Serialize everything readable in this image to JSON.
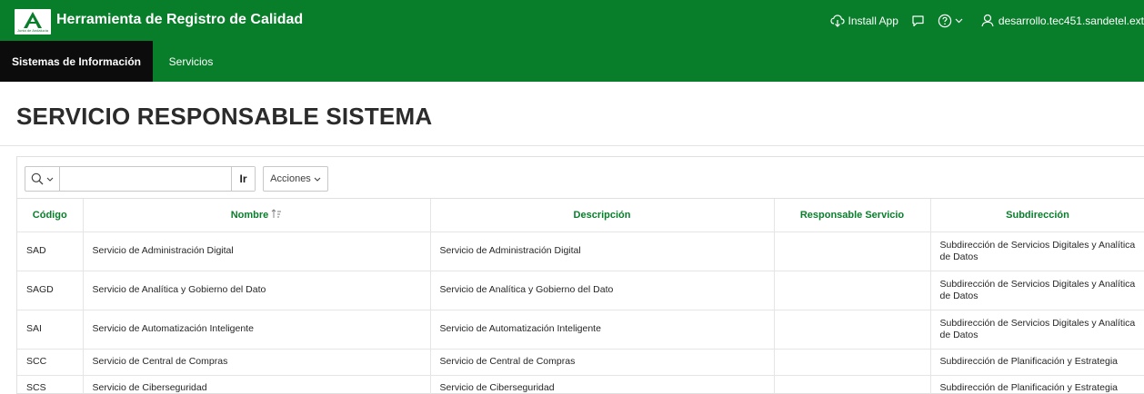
{
  "header": {
    "logo_text": "Junta de Andalucía",
    "title": "Herramienta de Registro de Calidad",
    "install_label": "Install App",
    "username": "desarrollo.tec451.sandetel.ext"
  },
  "nav": {
    "tabs": [
      {
        "label": "Sistemas de Información",
        "active": true
      },
      {
        "label": "Servicios",
        "active": false
      }
    ]
  },
  "page": {
    "title": "SERVICIO RESPONSABLE SISTEMA"
  },
  "toolbar": {
    "search_value": "",
    "search_placeholder": "",
    "go_label": "Ir",
    "actions_label": "Acciones"
  },
  "table": {
    "columns": [
      "Código",
      "Nombre",
      "Descripción",
      "Responsable Servicio",
      "Subdirección"
    ],
    "sorted_column": "Nombre",
    "rows": [
      {
        "codigo": "SAD",
        "nombre": "Servicio de Administración Digital",
        "descripcion": "Servicio de Administración Digital",
        "responsable": "",
        "subdireccion": "Subdirección de Servicios Digitales y Analítica de Datos"
      },
      {
        "codigo": "SAGD",
        "nombre": "Servicio de Analítica y Gobierno del Dato",
        "descripcion": "Servicio de Analítica y Gobierno del Dato",
        "responsable": "",
        "subdireccion": "Subdirección de Servicios Digitales y Analítica de Datos"
      },
      {
        "codigo": "SAI",
        "nombre": "Servicio de Automatización Inteligente",
        "descripcion": "Servicio de Automatización Inteligente",
        "responsable": "",
        "subdireccion": "Subdirección de Servicios Digitales y Analítica de Datos"
      },
      {
        "codigo": "SCC",
        "nombre": "Servicio de Central de Compras",
        "descripcion": "Servicio de Central de Compras",
        "responsable": "",
        "subdireccion": "Subdirección de Planificación y Estrategia"
      },
      {
        "codigo": "SCS",
        "nombre": "Servicio de Ciberseguridad",
        "descripcion": "Servicio de Ciberseguridad",
        "responsable": "",
        "subdireccion": "Subdirección de Planificación y Estrategia"
      }
    ]
  },
  "colors": {
    "brand_green": "#087e2b",
    "active_tab": "#0c0c0c"
  },
  "icons": {
    "logo": "junta-andalucia-logo",
    "install": "cloud-download-icon",
    "feedback": "chat-bubble-icon",
    "help": "help-circle-icon",
    "user": "user-icon",
    "search": "search-icon",
    "sort": "sort-ascending-icon"
  }
}
